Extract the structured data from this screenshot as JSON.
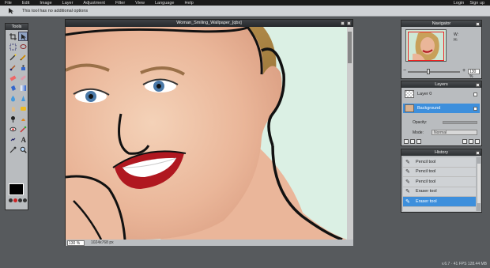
{
  "menu": {
    "items": [
      "File",
      "Edit",
      "Image",
      "Layer",
      "Adjustment",
      "Filter",
      "View",
      "Language",
      "Help"
    ],
    "login": "Login",
    "signup": "Sign up"
  },
  "options": {
    "message": "This tool has no additional options",
    "tool_icon": "move-arrow-icon"
  },
  "tools": {
    "title": "Tools",
    "buttons": [
      "crop-icon",
      "move-icon",
      "marquee-icon",
      "lasso-icon",
      "wand-icon",
      "pencil-icon",
      "brush-icon",
      "clone-icon",
      "eraser-icon",
      "spot-heal-icon",
      "bucket-icon",
      "gradient-icon",
      "blur-icon",
      "sharpen-icon",
      "smudge-icon",
      "sponge-icon",
      "dodge-icon",
      "burn-icon",
      "red-eye-icon",
      "color-replace-icon",
      "drawing-icon",
      "text-icon",
      "picker-icon",
      "zoom-icon"
    ],
    "foreground_color": "#000000"
  },
  "image_window": {
    "title": "Woman_Smiling_Wallpaper_[qbx]",
    "zoom": "130",
    "zoom_unit": "%",
    "dimensions": "1024x768 px"
  },
  "navigator": {
    "title": "Navigator",
    "w_label": "W:",
    "h_label": "H:",
    "zoom": "130",
    "zoom_unit": "%"
  },
  "layers": {
    "title": "Layers",
    "items": [
      {
        "name": "Layer 0",
        "selected": false
      },
      {
        "name": "Background",
        "selected": true
      }
    ],
    "opacity_label": "Opacity:",
    "mode_label": "Mode:",
    "mode_value": "Normal"
  },
  "history": {
    "title": "History",
    "items": [
      {
        "label": "Pencil tool",
        "selected": false
      },
      {
        "label": "Pencil tool",
        "selected": false
      },
      {
        "label": "Pencil tool",
        "selected": false
      },
      {
        "label": "Eraser tool",
        "selected": false
      },
      {
        "label": "Eraser tool",
        "selected": true
      }
    ]
  },
  "version": "v.6.7 · 41 FPS 128.44 MB",
  "colors": {
    "selection_blue": "#3d8fdc",
    "panel_gray": "#b9bcbf",
    "menubar": "#1a1a1a"
  }
}
